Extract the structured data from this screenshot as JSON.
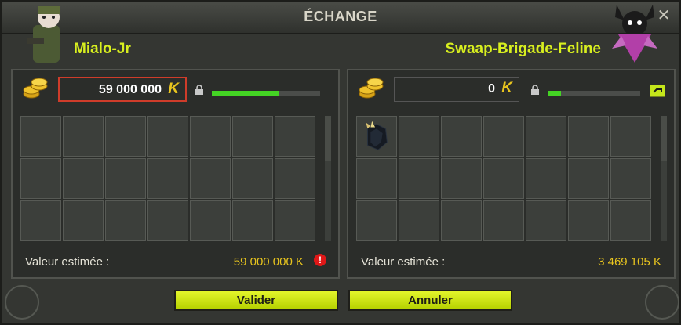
{
  "window": {
    "title": "ÉCHANGE",
    "close_glyph": "✕"
  },
  "left": {
    "player_name": "Mialo-Jr",
    "kamas": "59 000 000",
    "kamas_symbol": "K",
    "progress": 0.62,
    "estimated_label": "Valeur estimée :",
    "estimated_value": "59 000 000 K",
    "warning_glyph": "!"
  },
  "right": {
    "player_name": "Swaap-Brigade-Feline",
    "kamas": "0",
    "kamas_symbol": "K",
    "progress": 0.14,
    "estimated_label": "Valeur estimée :",
    "estimated_value": "3 469 105 K"
  },
  "buttons": {
    "validate": "Valider",
    "cancel": "Annuler"
  },
  "colors": {
    "accent": "#d8ef1f",
    "gold": "#e9c51e",
    "progress": "#44d424",
    "warning": "#e01818"
  },
  "icons": [
    "close-icon",
    "kamas-coins-icon",
    "lock-icon",
    "warning-icon",
    "ready-check-icon",
    "item-icon"
  ]
}
